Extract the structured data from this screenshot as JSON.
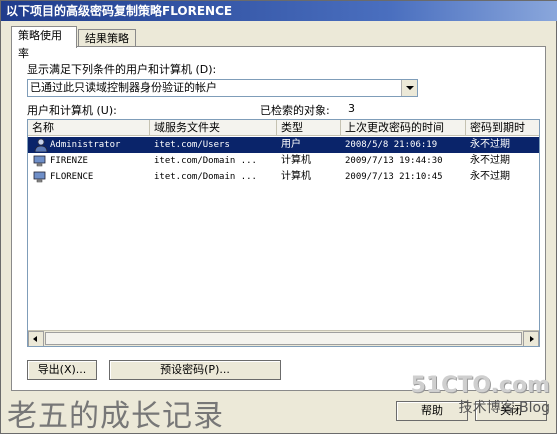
{
  "window": {
    "title": "以下项目的高级密码复制策略FLORENCE"
  },
  "tabs": [
    {
      "label": "策略使用率",
      "active": true
    },
    {
      "label": "结果策略",
      "active": false
    }
  ],
  "filter": {
    "label": "显示满足下列条件的用户和计算机 (D):",
    "selected": "已通过此只读域控制器身份验证的帐户"
  },
  "list": {
    "label": "用户和计算机 (U):",
    "count_label": "已检索的对象:",
    "count": "3",
    "columns": [
      "名称",
      "域服务文件夹",
      "类型",
      "上次更改密码的时间",
      "密码到期时"
    ],
    "rows": [
      {
        "icon": "user-icon",
        "name": "Administrator",
        "folder": "itet.com/Users",
        "type": "用户",
        "changed": "2008/5/8 21:06:19",
        "expires": "永不过期",
        "selected": true
      },
      {
        "icon": "computer-icon",
        "name": "FIRENZE",
        "folder": "itet.com/Domain ...",
        "type": "计算机",
        "changed": "2009/7/13 19:44:30",
        "expires": "永不过期",
        "selected": false
      },
      {
        "icon": "computer-icon",
        "name": "FLORENCE",
        "folder": "itet.com/Domain ...",
        "type": "计算机",
        "changed": "2009/7/13 21:10:45",
        "expires": "永不过期",
        "selected": false
      }
    ]
  },
  "buttons": {
    "export": "导出(X)...",
    "preset": "预设密码(P)...",
    "help": "帮助",
    "close": "关闭"
  },
  "watermark": {
    "left": "老五的成长记录",
    "site": "51CTO.com",
    "site_sub": "技术博客 Blog"
  },
  "colors": {
    "selection": "#0a246a",
    "titlebar": "#1f3c8c"
  }
}
